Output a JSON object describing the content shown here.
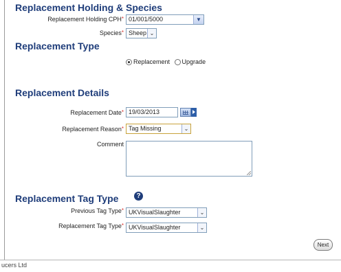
{
  "holding_section": {
    "heading": "Replacement Holding & Species",
    "cph_label": "Replacement Holding CPH",
    "cph_value": "01/001/5000",
    "species_label": "Species",
    "species_value": "Sheep"
  },
  "type_section": {
    "heading": "Replacement Type",
    "options": [
      {
        "label": "Replacement",
        "checked": true
      },
      {
        "label": "Upgrade",
        "checked": false
      }
    ]
  },
  "details_section": {
    "heading": "Replacement Details",
    "date_label": "Replacement Date",
    "date_value": "19/03/2013",
    "reason_label": "Replacement Reason",
    "reason_value": "Tag Missing",
    "comment_label": "Comment",
    "comment_value": ""
  },
  "tag_section": {
    "heading": "Replacement Tag Type",
    "previous_label": "Previous Tag Type",
    "previous_value": "UKVisualSlaughter",
    "replacement_label": "Replacement Tag Type",
    "replacement_value": "UKVisualSlaughter"
  },
  "actions": {
    "next_label": "Next"
  },
  "footer": {
    "text": "ucers Ltd"
  },
  "required_marker": "*",
  "icons": {
    "help": "?",
    "dropdown": "▼",
    "select_arrow": "⌄"
  },
  "colors": {
    "heading": "#1f3d7a",
    "required": "#d9302c",
    "field_border": "#7f9db9"
  }
}
